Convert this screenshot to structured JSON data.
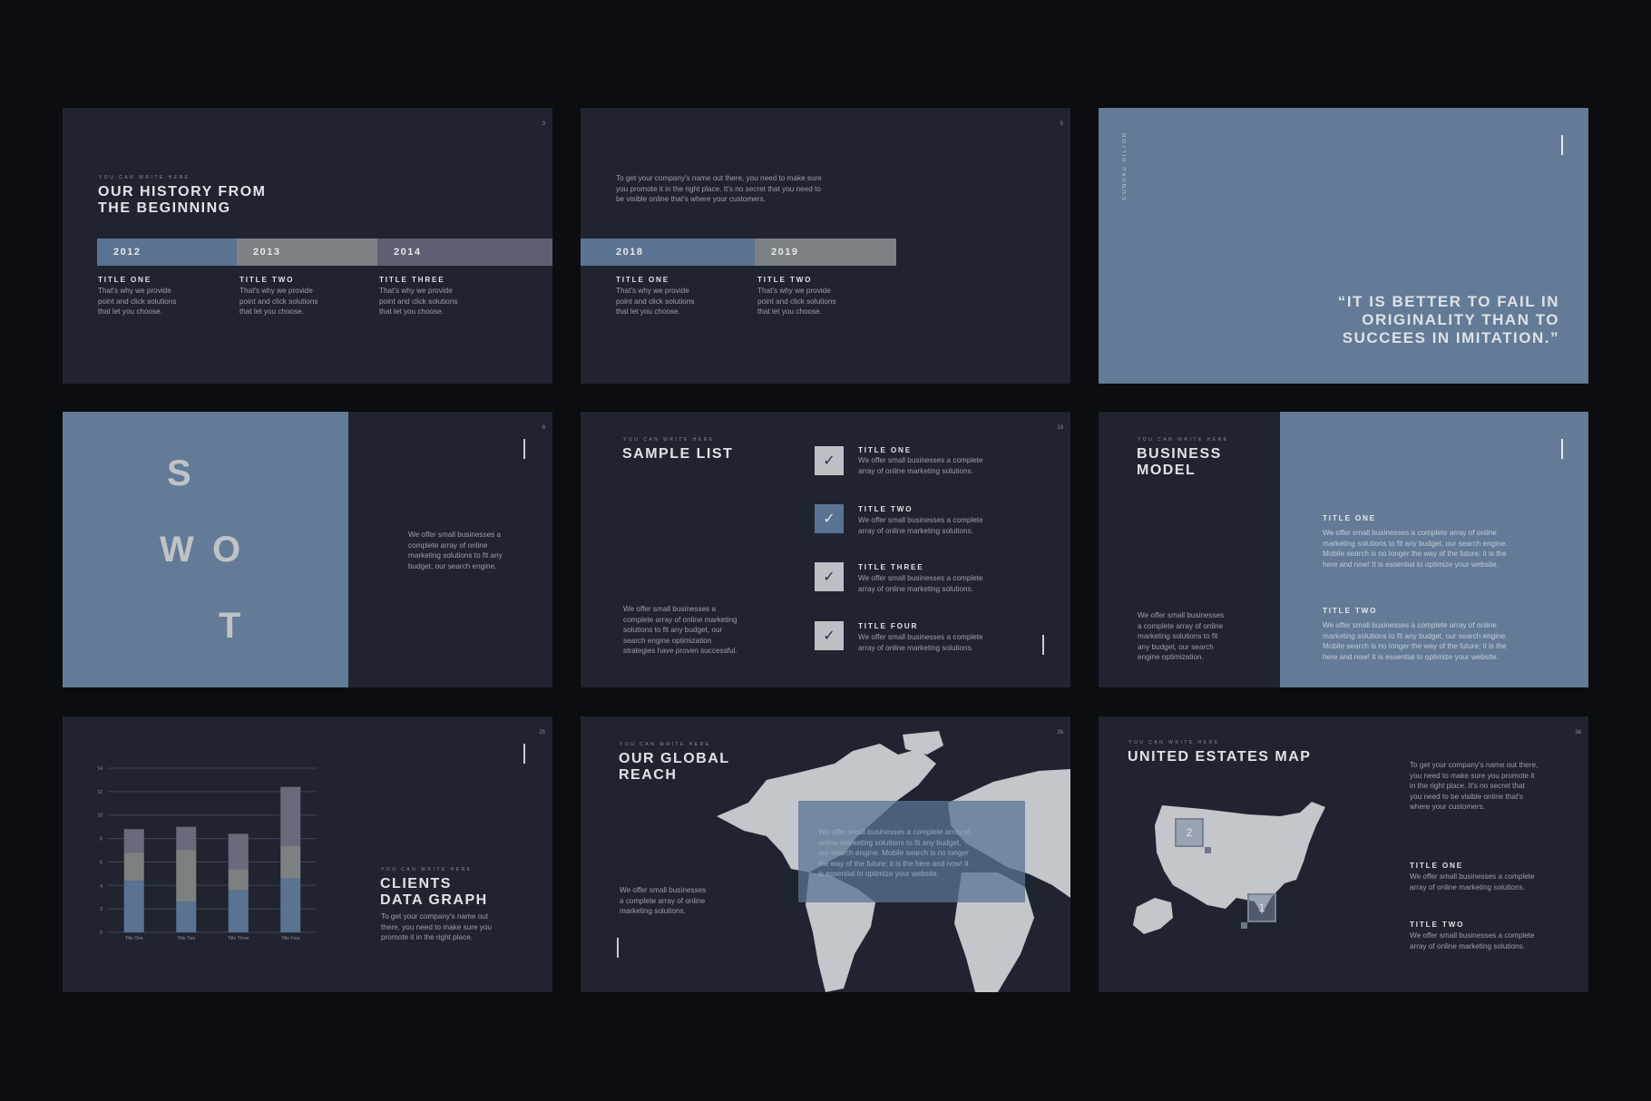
{
  "slides": {
    "history": {
      "page_num": "3",
      "kicker": "YOU CAN WRITE HERE",
      "title_line1": "OUR HISTORY FROM",
      "title_line2": "THE BEGINNING",
      "years": [
        "2012",
        "2013",
        "2014"
      ],
      "items": [
        {
          "title": "TITLE ONE",
          "l1": "That's why we provide",
          "l2": "point and click solutions",
          "l3": "that let you choose."
        },
        {
          "title": "TITLE TWO",
          "l1": "That's why we provide",
          "l2": "point and click solutions",
          "l3": "that let you choose."
        },
        {
          "title": "TITLE THREE",
          "l1": "That's why we provide",
          "l2": "point and click solutions",
          "l3": "that let you choose."
        }
      ]
    },
    "history2": {
      "page_num": "5",
      "intro_l1": "To get your company's name out there, you need to make sure",
      "intro_l2": "you promote it in the right place. It's no secret that you need to",
      "intro_l3": "be visible online that's where your customers.",
      "years": [
        "2018",
        "2019"
      ],
      "items": [
        {
          "title": "TITLE ONE",
          "l1": "That's why we provide",
          "l2": "point and click solutions",
          "l3": "that let you choose."
        },
        {
          "title": "TITLE TWO",
          "l1": "That's why we provide",
          "l2": "point and click solutions",
          "l3": "that let you choose."
        }
      ]
    },
    "quote": {
      "author": "CONRAD HILTON",
      "l1": "“IT IS BETTER TO FAIL IN",
      "l2": "ORIGINALITY THAN TO",
      "l3": "SUCCEES IN IMITATION.”"
    },
    "swot": {
      "page_num": "8",
      "letters": [
        "S",
        "W",
        "O",
        "T"
      ],
      "l1": "We offer small businesses a",
      "l2": "complete array of online",
      "l3": "marketing solutions to fit any",
      "l4": "budget, our search engine."
    },
    "list": {
      "page_num": "13",
      "kicker": "YOU CAN WRITE HERE",
      "title": "SAMPLE LIST",
      "desc": [
        "We offer small businesses a",
        "complete array of online marketing",
        "solutions to fit any budget, our",
        "search engine optimization",
        "strategies have proven successful."
      ],
      "items": [
        {
          "title": "TITLE ONE",
          "l1": "We offer small businesses a complete",
          "l2": "array of online marketing solutions."
        },
        {
          "title": "TITLE TWO",
          "l1": "We offer small businesses a complete",
          "l2": "array of online marketing solutions."
        },
        {
          "title": "TITLE THREE",
          "l1": "We offer small businesses a complete",
          "l2": "array of online marketing solutions."
        },
        {
          "title": "TITLE FOUR",
          "l1": "We offer small businesses a complete",
          "l2": "array of online marketing solutions."
        }
      ],
      "check_glyph": "✓"
    },
    "business": {
      "kicker": "YOU CAN WRITE HERE",
      "title_line1": "BUSINESS",
      "title_line2": "MODEL",
      "desc": [
        "We offer small businesses",
        "a complete array of online",
        "marketing solutions to fit",
        "any budget, our search",
        "engine optimization."
      ],
      "items": [
        {
          "title": "TITLE ONE",
          "l1": "We offer small businesses a complete array of online",
          "l2": "marketing solutions to fit any budget, our search engine.",
          "l3": "Mobile search is no longer the way of the future; it is the",
          "l4": "here and now! It is essential to optimize your website."
        },
        {
          "title": "TITLE TWO",
          "l1": "We offer small businesses a complete array of online",
          "l2": "marketing solutions to fit any budget, our search engine.",
          "l3": "Mobile search is no longer the way of the future; it is the",
          "l4": "here and now! It is essential to optimize your website."
        }
      ]
    },
    "graph": {
      "page_num": "25",
      "kicker": "YOU CAN WRITE HERE",
      "title_line1": "CLIENTS",
      "title_line2": "DATA GRAPH",
      "desc": [
        "To get your company's name out",
        "there, you need to make sure you",
        "promote it in the right place."
      ]
    },
    "global": {
      "page_num": "26",
      "kicker": "YOU CAN WRITE HERE",
      "title_line1": "OUR GLOBAL",
      "title_line2": "REACH",
      "desc": [
        "We offer small businesses",
        "a complete array of online",
        "marketing solutions."
      ],
      "overlay": [
        "We offer small businesses a complete array of",
        "online marketing solutions to fit any budget,",
        "our search engine. Mobile search is no longer",
        "the way of the future; it is the here and now! It",
        "is essential to optimize your website."
      ]
    },
    "usmap": {
      "page_num": "36",
      "kicker": "YOU CAN WRITE HERE",
      "title": "UNITED ESTATES MAP",
      "intro": [
        "To get your company's name out there,",
        "you need to make sure you promote it",
        "in the right place. It's no secret that",
        "you need to be visible online that's",
        "where your customers."
      ],
      "items": [
        {
          "title": "TITLE ONE",
          "l1": "We offer small businesses a complete",
          "l2": "array of online marketing solutions."
        },
        {
          "title": "TITLE TWO",
          "l1": "We offer small businesses a complete",
          "l2": "array of online marketing solutions."
        }
      ],
      "markers": [
        "2",
        "1"
      ]
    }
  },
  "chart_data": {
    "type": "bar",
    "stacked": true,
    "categories": [
      "Title One",
      "Title Two",
      "Title Three",
      "Title Four"
    ],
    "series": [
      {
        "values": [
          4.4,
          2.6,
          3.6,
          4.6
        ],
        "color": "#5b7393"
      },
      {
        "values": [
          2.4,
          4.4,
          1.8,
          2.8
        ],
        "color": "#7a8180"
      },
      {
        "values": [
          2.0,
          2.0,
          3.0,
          5.0
        ],
        "color": "#6a6a7d"
      }
    ],
    "yticks": [
      "0",
      "2",
      "4",
      "6",
      "8",
      "10",
      "12",
      "14"
    ],
    "ylim": [
      0,
      14
    ],
    "grid": true
  },
  "colors": {
    "background": "#0b0d11",
    "slide_dark": "#1f2430",
    "slide_blue": "#637b96",
    "band_blue": "#5b7393",
    "band_gray": "#7d8186",
    "band_purple": "#5e5f72"
  }
}
